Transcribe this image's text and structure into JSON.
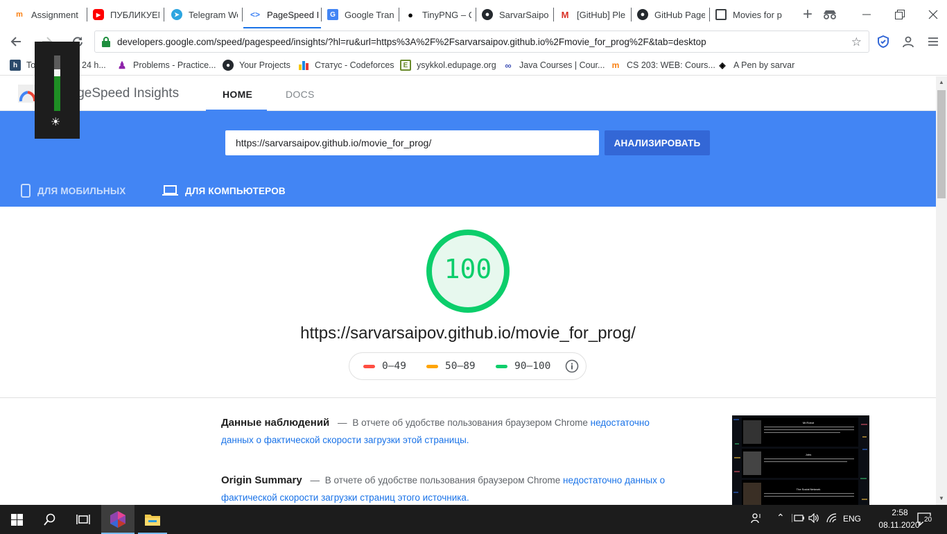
{
  "browser": {
    "tabs": [
      {
        "label": "Assignment",
        "icon": "moodle-hat-icon",
        "active": false
      },
      {
        "label": "ПУБЛИКУЕМ",
        "icon": "youtube-icon",
        "active": false
      },
      {
        "label": "Telegram We",
        "icon": "telegram-icon",
        "active": false
      },
      {
        "label": "PageSpeed I",
        "icon": "pagespeed-icon",
        "active": true
      },
      {
        "label": "Google Tran",
        "icon": "google-translate-icon",
        "active": false
      },
      {
        "label": "TinyPNG – C",
        "icon": "tinypng-panda-icon",
        "active": false
      },
      {
        "label": "SarvarSaipov",
        "icon": "github-icon",
        "active": false
      },
      {
        "label": "[GitHub] Ple",
        "icon": "gmail-icon",
        "active": false
      },
      {
        "label": "GitHub Page",
        "icon": "github-icon",
        "active": false
      },
      {
        "label": "Movies for p",
        "icon": "page-icon",
        "active": false
      }
    ],
    "new_tab_label": "+",
    "address": "developers.google.com/speed/pagespeed/insights/?hl=ru&url=https%3A%2F%2Fsarvarsaipov.github.io%2Fmovie_for_prog%2F&tab=desktop",
    "bookmarks": [
      {
        "label": "To",
        "icon": "hatena-h-icon"
      },
      {
        "label": "24 h...",
        "icon": ""
      },
      {
        "label": "Problems - Practice...",
        "icon": "among-us-icon"
      },
      {
        "label": "Your Projects",
        "icon": "github-icon"
      },
      {
        "label": "Статус - Codeforces",
        "icon": "codeforces-icon"
      },
      {
        "label": "ysykkol.edupage.org",
        "icon": "edupage-icon"
      },
      {
        "label": "Java Courses | Cour...",
        "icon": "link-icon"
      },
      {
        "label": "CS 203: WEB: Cours...",
        "icon": "moodle-hat-icon"
      },
      {
        "label": "A Pen by sarvar",
        "icon": "codepen-icon"
      }
    ]
  },
  "psi": {
    "title": "PageSpeed Insights",
    "nav": {
      "home": "HOME",
      "docs": "DOCS"
    },
    "url_value": "https://sarvarsaipov.github.io/movie_for_prog/",
    "analyze_label": "АНАЛИЗИРОВАТЬ",
    "tabs": {
      "mobile": "ДЛЯ МОБИЛЬНЫХ",
      "desktop": "ДЛЯ КОМПЬЮТЕРОВ"
    },
    "score": "100",
    "score_fraction": 1.0,
    "tested_url": "https://sarvarsaipov.github.io/movie_for_prog/",
    "legend": [
      {
        "range": "0–49",
        "color": "#ff4e42"
      },
      {
        "range": "50–89",
        "color": "#ffa400"
      },
      {
        "range": "90–100",
        "color": "#0cce6b"
      }
    ],
    "field_data": {
      "title": "Данные наблюдений",
      "dash": "—",
      "text": "В отчете об удобстве пользования браузером Chrome",
      "link": "недостаточно данных о фактической скорости загрузки этой страницы."
    },
    "origin_summary": {
      "title": "Origin Summary",
      "dash": "—",
      "text": "В отчете об удобстве пользования браузером Chrome",
      "link": "недостаточно данных о фактической скорости загрузки страниц этого источника."
    },
    "thumbnail_titles": [
      "Mr.Robot",
      "Jobs",
      "The Social Network"
    ]
  },
  "brightness": {
    "level": 0.75
  },
  "taskbar": {
    "lang": "ENG",
    "time": "2:58",
    "date": "08.11.2020",
    "notifications": "20"
  },
  "colors": {
    "accent": "#4285f4",
    "button": "#3367d6",
    "score_good": "#0cce6b"
  }
}
